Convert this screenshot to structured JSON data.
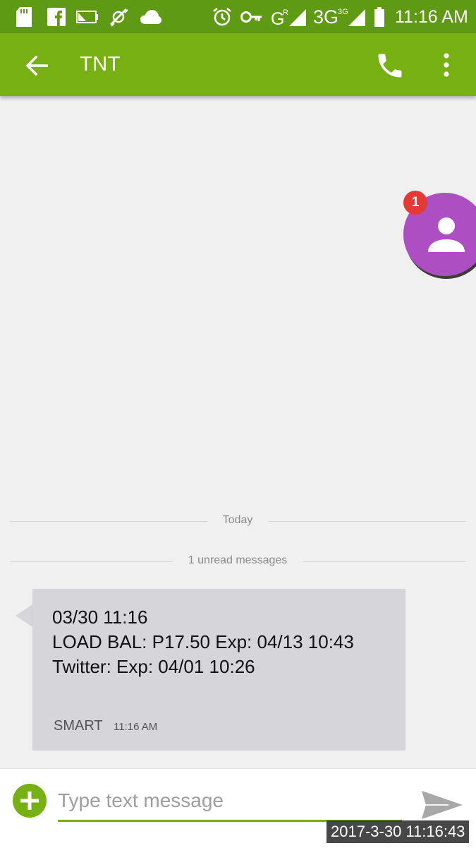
{
  "status_bar": {
    "network": "3G",
    "time": "11:16 AM",
    "icons": [
      "sd-card-icon",
      "facebook-icon",
      "battery-low-icon",
      "usb-debug-icon",
      "cloud-icon",
      "alarm-icon",
      "vpn-key-icon",
      "signal-roaming-icon",
      "signal-3g-icon",
      "battery-icon"
    ]
  },
  "app_bar": {
    "title": "TNT"
  },
  "avatar": {
    "badge_count": "1"
  },
  "conversation": {
    "date_divider": "Today",
    "unread_divider": "1 unread messages",
    "messages": [
      {
        "lines": [
          "03/30 11:16",
          "LOAD BAL: P17.50 Exp: 04/13 10:43",
          "Twitter: Exp: 04/01 10:26"
        ],
        "sender": "SMART",
        "time": "11:16 AM"
      }
    ]
  },
  "composer": {
    "placeholder": "Type text message"
  },
  "screenshot_stamp": "2017-3-30 11:16:43",
  "colors": {
    "status_bar": "#5f9a14",
    "app_bar": "#76b012",
    "accent": "#76b012",
    "avatar": "#ad4fc3",
    "badge": "#e53935",
    "bubble": "#d6d5d9"
  }
}
